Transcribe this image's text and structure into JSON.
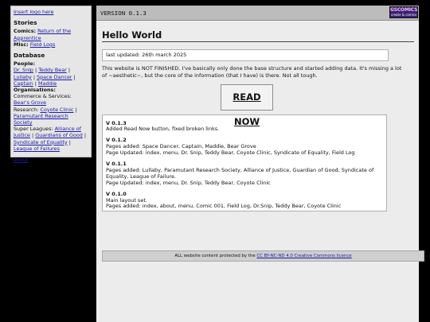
{
  "sidebar": {
    "logo_link": "Insert logo here",
    "stories_heading": "Stories",
    "comics_label": "Comics:",
    "comics_link": "Return of the Apprentice",
    "misc_label": "Misc:",
    "misc_link": "Field Logs",
    "database_heading": "Database",
    "people_label": "People:",
    "people": [
      "Dr. Snip",
      "Teddy Bear",
      "Lullaby",
      "Space Dancer",
      "Captain",
      "Maddie"
    ],
    "organisations_label": "Organisations:",
    "commerce_label": "Commerce & Services:",
    "commerce_link": "Bear's Grove",
    "research_label": "Research:",
    "research_links": [
      "Coyote Clinic",
      "Paramutant Research Society"
    ],
    "superleagues_label": "Super Leagues:",
    "superleagues_links": [
      "Alliance of Justice",
      "Guardians of Good",
      "Syndicate of Equality",
      "League of Failures"
    ],
    "about_link": "about"
  },
  "topbar": {
    "version": "VERSION 0.1.3",
    "badge_line1": "GSCOMICS",
    "badge_line2": "create & comics"
  },
  "main": {
    "title": "Hello World",
    "last_updated": "last updated: 26th march 2025",
    "notice": "This website is NOT FINISHED. I've basically only done the base structure and started adding data. It's missing a lot of ~aesthetic~, but the core of the information (that I have) is there. Not all tough.",
    "read_now": "READ NOW"
  },
  "changelog": [
    {
      "version": "V 0.1.3",
      "lines": [
        "Added Read Now button, fixed broken links."
      ]
    },
    {
      "version": "V 0.1.2",
      "lines": [
        "Pages added: Space Dancer, Captain, Maddie, Bear Grove",
        "Page Updated: index, menu, Dr. Snip, Teddy Bear, Coyote Clinic, Syndicate of Equality, Field Log"
      ]
    },
    {
      "version": "V 0.1.1",
      "lines": [
        "Pages added: Lullaby, Paramutant Research Society, Alliance of Justice, Guardian of Good, Syndicate of Equality, League of Failure.",
        "Page Updated: index, menu, Dr. Snip, Teddy Bear, Coyote Clinic"
      ]
    },
    {
      "version": "V 0.1.0",
      "lines": [
        "Main layout set.",
        "Pages added: index, about, menu, Comic 001, Field Log, Dr.Snip, Teddy Bear, Coyote Clinic"
      ]
    }
  ],
  "footer": {
    "text": "ALL website content protected by the",
    "license_link": "CC BY-NC-ND 4.0 Creative Commons licence"
  },
  "colors": {
    "background": "#000000",
    "sidebar_bg": "#e6e6e6",
    "main_bg": "#ececec",
    "topbar_bg": "#bcbcbc",
    "link": "#1a1aa6"
  }
}
